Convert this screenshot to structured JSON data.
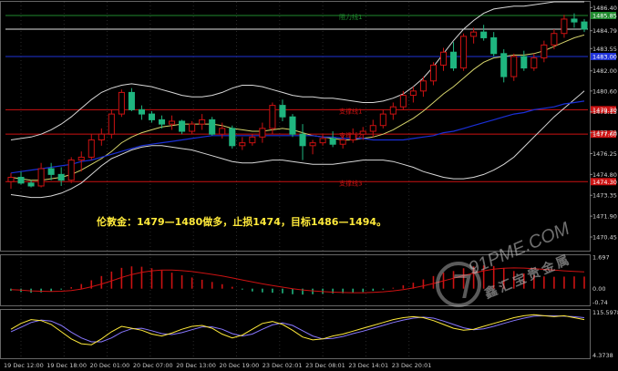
{
  "annotation": "伦敦金：1479—1480做多，止损1474，目标1486—1494。",
  "watermark": {
    "brand": "91PME.COM",
    "tagline": "鑫汇宝贵金属"
  },
  "colors": {
    "background": "#000000",
    "grid": "#2a2a2a",
    "bull": "#ffffff",
    "bear": "#1fb57f",
    "bb": "#d8d8d8",
    "ma_fast": "#d6d46c",
    "ma_slow": "#1a2fd6",
    "resistance": "#1f8a2e",
    "support": "#cc1212",
    "macd_signal": "#cc1212",
    "stoch_k": "#ffea3b",
    "stoch_d": "#8877ff",
    "text": "#ffea3b"
  },
  "chart_data": [
    {
      "type": "candlestick",
      "panel": "price",
      "ylim": [
        1469.5,
        1486.8
      ],
      "y_ticks": [
        "1486.40",
        "1484.79",
        "1483.55",
        "1482.00",
        "1480.60",
        "1479.15",
        "1477.70",
        "1476.25",
        "1474.80",
        "1473.35",
        "1471.90",
        "1470.45"
      ],
      "y_tick_values": [
        1486.4,
        1484.79,
        1483.55,
        1482.0,
        1480.6,
        1479.15,
        1477.7,
        1476.25,
        1474.8,
        1473.35,
        1471.9,
        1470.45
      ],
      "x_ticks": [
        "19 Dec 12:00",
        "19 Dec 18:00",
        "20 Dec 01:00",
        "20 Dec 07:00",
        "20 Dec 13:00",
        "20 Dec 19:00",
        "23 Dec 02:01",
        "23 Dec 08:01",
        "23 Dec 14:01",
        "23 Dec 20:01"
      ],
      "levels": [
        {
          "label": "阻力线1",
          "value": 1485.85,
          "kind": "resistance",
          "tag": "1485.85"
        },
        {
          "label": "",
          "value": 1483.0,
          "kind": "current",
          "tag": "1483.00"
        },
        {
          "label": "支撑线1",
          "value": 1479.3,
          "kind": "support",
          "tag": "1479.30"
        },
        {
          "label": "支撑线2",
          "value": 1477.6,
          "kind": "support",
          "tag": "1477.60"
        },
        {
          "label": "支撑线3",
          "value": 1474.3,
          "kind": "support",
          "tag": "1474.30"
        }
      ],
      "ohlc": [
        [
          1474.3,
          1474.9,
          1473.8,
          1474.6
        ],
        [
          1474.6,
          1475.0,
          1474.1,
          1474.2
        ],
        [
          1474.2,
          1474.4,
          1473.9,
          1474.0
        ],
        [
          1474.0,
          1475.6,
          1473.9,
          1475.2
        ],
        [
          1475.2,
          1475.6,
          1474.4,
          1474.8
        ],
        [
          1474.8,
          1475.3,
          1474.0,
          1474.4
        ],
        [
          1474.4,
          1476.0,
          1474.2,
          1475.8
        ],
        [
          1475.8,
          1476.4,
          1475.0,
          1476.0
        ],
        [
          1476.0,
          1477.6,
          1475.8,
          1477.2
        ],
        [
          1477.2,
          1478.0,
          1476.8,
          1477.6
        ],
        [
          1477.6,
          1479.3,
          1477.3,
          1479.0
        ],
        [
          1479.0,
          1480.7,
          1478.8,
          1480.5
        ],
        [
          1480.5,
          1480.8,
          1479.2,
          1479.3
        ],
        [
          1479.3,
          1479.6,
          1478.6,
          1479.0
        ],
        [
          1479.0,
          1479.2,
          1478.4,
          1478.6
        ],
        [
          1478.6,
          1478.9,
          1478.0,
          1478.3
        ],
        [
          1478.3,
          1478.9,
          1477.9,
          1478.5
        ],
        [
          1478.5,
          1478.6,
          1477.6,
          1477.8
        ],
        [
          1477.8,
          1478.5,
          1477.6,
          1478.3
        ],
        [
          1478.3,
          1479.0,
          1477.9,
          1478.6
        ],
        [
          1478.6,
          1478.8,
          1477.5,
          1477.6
        ],
        [
          1477.6,
          1478.4,
          1477.3,
          1478.0
        ],
        [
          1478.0,
          1478.2,
          1476.6,
          1476.8
        ],
        [
          1476.8,
          1477.4,
          1476.5,
          1477.0
        ],
        [
          1477.0,
          1477.6,
          1476.8,
          1477.4
        ],
        [
          1477.4,
          1478.4,
          1477.0,
          1478.0
        ],
        [
          1478.0,
          1479.8,
          1477.6,
          1479.6
        ],
        [
          1479.6,
          1480.0,
          1478.5,
          1478.8
        ],
        [
          1478.8,
          1479.0,
          1477.4,
          1477.6
        ],
        [
          1477.6,
          1478.3,
          1475.8,
          1476.8
        ],
        [
          1476.8,
          1477.2,
          1476.2,
          1477.0
        ],
        [
          1477.0,
          1477.6,
          1476.8,
          1477.3
        ],
        [
          1477.3,
          1477.8,
          1476.7,
          1476.9
        ],
        [
          1476.9,
          1477.5,
          1476.6,
          1477.2
        ],
        [
          1477.2,
          1478.0,
          1477.0,
          1477.6
        ],
        [
          1477.6,
          1478.1,
          1477.2,
          1477.8
        ],
        [
          1477.8,
          1478.6,
          1477.4,
          1478.2
        ],
        [
          1478.2,
          1479.3,
          1478.0,
          1479.0
        ],
        [
          1479.0,
          1479.8,
          1478.6,
          1479.5
        ],
        [
          1479.5,
          1480.6,
          1479.3,
          1480.3
        ],
        [
          1480.3,
          1480.9,
          1479.8,
          1480.6
        ],
        [
          1480.6,
          1481.6,
          1480.2,
          1481.3
        ],
        [
          1481.3,
          1482.6,
          1481.0,
          1482.4
        ],
        [
          1482.4,
          1483.6,
          1482.0,
          1483.3
        ],
        [
          1483.3,
          1484.0,
          1482.0,
          1482.2
        ],
        [
          1482.2,
          1484.6,
          1482.0,
          1484.4
        ],
        [
          1484.4,
          1485.0,
          1483.9,
          1484.7
        ],
        [
          1484.7,
          1485.2,
          1484.1,
          1484.3
        ],
        [
          1484.3,
          1484.7,
          1483.0,
          1483.2
        ],
        [
          1483.2,
          1483.5,
          1481.2,
          1481.6
        ],
        [
          1481.6,
          1483.2,
          1481.3,
          1483.0
        ],
        [
          1483.0,
          1483.4,
          1482.0,
          1482.2
        ],
        [
          1482.2,
          1483.2,
          1482.0,
          1482.9
        ],
        [
          1482.9,
          1484.1,
          1482.6,
          1483.8
        ],
        [
          1483.8,
          1484.9,
          1483.5,
          1484.6
        ],
        [
          1484.6,
          1485.9,
          1484.3,
          1485.6
        ],
        [
          1485.6,
          1486.0,
          1485.0,
          1485.4
        ],
        [
          1485.4,
          1485.6,
          1484.7,
          1484.9
        ]
      ],
      "bollinger_upper": [
        1477.2,
        1477.3,
        1477.4,
        1477.6,
        1477.9,
        1478.3,
        1478.8,
        1479.4,
        1480.0,
        1480.5,
        1480.8,
        1481.0,
        1481.1,
        1481.0,
        1480.9,
        1480.7,
        1480.5,
        1480.3,
        1480.2,
        1480.2,
        1480.3,
        1480.5,
        1480.8,
        1481.0,
        1481.0,
        1480.9,
        1480.7,
        1480.5,
        1480.3,
        1480.2,
        1480.2,
        1480.1,
        1480.1,
        1480.0,
        1479.9,
        1479.8,
        1479.8,
        1479.9,
        1480.1,
        1480.4,
        1480.9,
        1481.5,
        1482.3,
        1483.2,
        1484.1,
        1484.9,
        1485.5,
        1486.0,
        1486.3,
        1486.4,
        1486.5,
        1486.5,
        1486.6,
        1486.7,
        1486.8,
        1486.8,
        1486.8,
        1486.8
      ],
      "bollinger_lower": [
        1473.4,
        1473.3,
        1473.2,
        1473.2,
        1473.3,
        1473.5,
        1473.8,
        1474.2,
        1474.8,
        1475.4,
        1475.9,
        1476.2,
        1476.5,
        1476.7,
        1476.8,
        1476.8,
        1476.7,
        1476.6,
        1476.5,
        1476.3,
        1476.1,
        1475.9,
        1475.7,
        1475.6,
        1475.6,
        1475.7,
        1475.8,
        1475.8,
        1475.7,
        1475.6,
        1475.5,
        1475.5,
        1475.5,
        1475.6,
        1475.7,
        1475.8,
        1475.8,
        1475.8,
        1475.7,
        1475.5,
        1475.3,
        1475.0,
        1474.8,
        1474.6,
        1474.5,
        1474.5,
        1474.6,
        1474.8,
        1475.1,
        1475.5,
        1476.0,
        1476.7,
        1477.4,
        1478.1,
        1478.8,
        1479.4,
        1480.0,
        1480.6
      ],
      "ma_fast": [
        1474.6,
        1474.5,
        1474.4,
        1474.4,
        1474.5,
        1474.6,
        1474.8,
        1475.1,
        1475.5,
        1475.9,
        1476.4,
        1477.0,
        1477.4,
        1477.7,
        1477.9,
        1478.1,
        1478.2,
        1478.3,
        1478.3,
        1478.3,
        1478.3,
        1478.2,
        1478.0,
        1477.9,
        1477.8,
        1477.8,
        1477.9,
        1478.0,
        1477.9,
        1477.7,
        1477.5,
        1477.4,
        1477.3,
        1477.2,
        1477.2,
        1477.3,
        1477.4,
        1477.6,
        1477.9,
        1478.3,
        1478.7,
        1479.2,
        1479.8,
        1480.4,
        1480.9,
        1481.5,
        1482.1,
        1482.6,
        1482.9,
        1483.0,
        1483.1,
        1483.1,
        1483.2,
        1483.4,
        1483.7,
        1484.0,
        1484.3,
        1484.5
      ],
      "ma_slow": [
        1474.9,
        1475.0,
        1475.1,
        1475.2,
        1475.3,
        1475.4,
        1475.5,
        1475.7,
        1475.8,
        1476.0,
        1476.2,
        1476.4,
        1476.6,
        1476.8,
        1476.9,
        1477.0,
        1477.1,
        1477.2,
        1477.3,
        1477.4,
        1477.5,
        1477.5,
        1477.5,
        1477.5,
        1477.5,
        1477.5,
        1477.5,
        1477.5,
        1477.5,
        1477.5,
        1477.5,
        1477.4,
        1477.4,
        1477.3,
        1477.3,
        1477.3,
        1477.2,
        1477.2,
        1477.2,
        1477.2,
        1477.3,
        1477.4,
        1477.5,
        1477.7,
        1477.8,
        1478.0,
        1478.2,
        1478.4,
        1478.6,
        1478.8,
        1479.0,
        1479.1,
        1479.3,
        1479.4,
        1479.5,
        1479.7,
        1479.8,
        1479.9
      ]
    },
    {
      "type": "bar",
      "panel": "macd",
      "ylim": [
        -0.9,
        1.8
      ],
      "y_ticks": [
        "1.697",
        "0.00",
        "-0.74"
      ],
      "y_tick_values": [
        1.697,
        0.0,
        -0.74
      ],
      "histogram": [
        -0.12,
        -0.18,
        -0.22,
        -0.2,
        -0.14,
        -0.05,
        0.08,
        0.25,
        0.45,
        0.68,
        0.92,
        1.12,
        1.2,
        1.18,
        1.1,
        0.98,
        0.86,
        0.72,
        0.6,
        0.48,
        0.36,
        0.24,
        0.1,
        -0.05,
        -0.15,
        -0.2,
        -0.22,
        -0.25,
        -0.3,
        -0.32,
        -0.3,
        -0.28,
        -0.26,
        -0.25,
        -0.22,
        -0.18,
        -0.12,
        -0.05,
        0.05,
        0.18,
        0.32,
        0.5,
        0.68,
        0.86,
        0.95,
        1.1,
        1.2,
        1.25,
        1.22,
        1.1,
        0.95,
        0.82,
        0.72,
        0.66,
        0.64,
        0.65,
        0.66,
        0.65
      ],
      "signal": [
        -0.05,
        -0.08,
        -0.12,
        -0.14,
        -0.15,
        -0.14,
        -0.1,
        -0.02,
        0.1,
        0.25,
        0.42,
        0.6,
        0.76,
        0.88,
        0.96,
        1.0,
        1.0,
        0.97,
        0.92,
        0.85,
        0.77,
        0.68,
        0.58,
        0.47,
        0.36,
        0.26,
        0.17,
        0.08,
        0.0,
        -0.07,
        -0.12,
        -0.16,
        -0.19,
        -0.21,
        -0.22,
        -0.22,
        -0.2,
        -0.17,
        -0.12,
        -0.05,
        0.04,
        0.15,
        0.28,
        0.42,
        0.56,
        0.7,
        0.84,
        0.96,
        1.05,
        1.1,
        1.12,
        1.11,
        1.08,
        1.04,
        1.0,
        0.96,
        0.93,
        0.9
      ]
    },
    {
      "type": "line",
      "panel": "stochastic",
      "ylim": [
        0,
        100
      ],
      "y_ticks": [
        "115.5978",
        "4.3738"
      ],
      "y_tick_values": [
        115.5978,
        4.3738
      ],
      "series": [
        {
          "name": "",
          "role": "k",
          "values": [
            60,
            72,
            80,
            78,
            70,
            55,
            40,
            30,
            28,
            40,
            55,
            66,
            62,
            58,
            50,
            46,
            52,
            60,
            66,
            68,
            62,
            50,
            42,
            48,
            60,
            72,
            76,
            70,
            58,
            44,
            38,
            40,
            46,
            50,
            56,
            62,
            68,
            74,
            80,
            84,
            86,
            84,
            78,
            70,
            62,
            58,
            60,
            66,
            72,
            78,
            84,
            88,
            90,
            88,
            86,
            88,
            84,
            80
          ]
        },
        {
          "name": "",
          "role": "d",
          "values": [
            55,
            64,
            74,
            79,
            77,
            68,
            54,
            42,
            34,
            34,
            42,
            54,
            61,
            62,
            57,
            51,
            49,
            53,
            59,
            65,
            65,
            60,
            51,
            46,
            50,
            60,
            69,
            73,
            68,
            57,
            46,
            40,
            41,
            45,
            51,
            56,
            62,
            68,
            74,
            79,
            83,
            85,
            83,
            77,
            70,
            63,
            59,
            61,
            66,
            72,
            78,
            83,
            87,
            88,
            88,
            87,
            86,
            84
          ]
        }
      ]
    }
  ]
}
